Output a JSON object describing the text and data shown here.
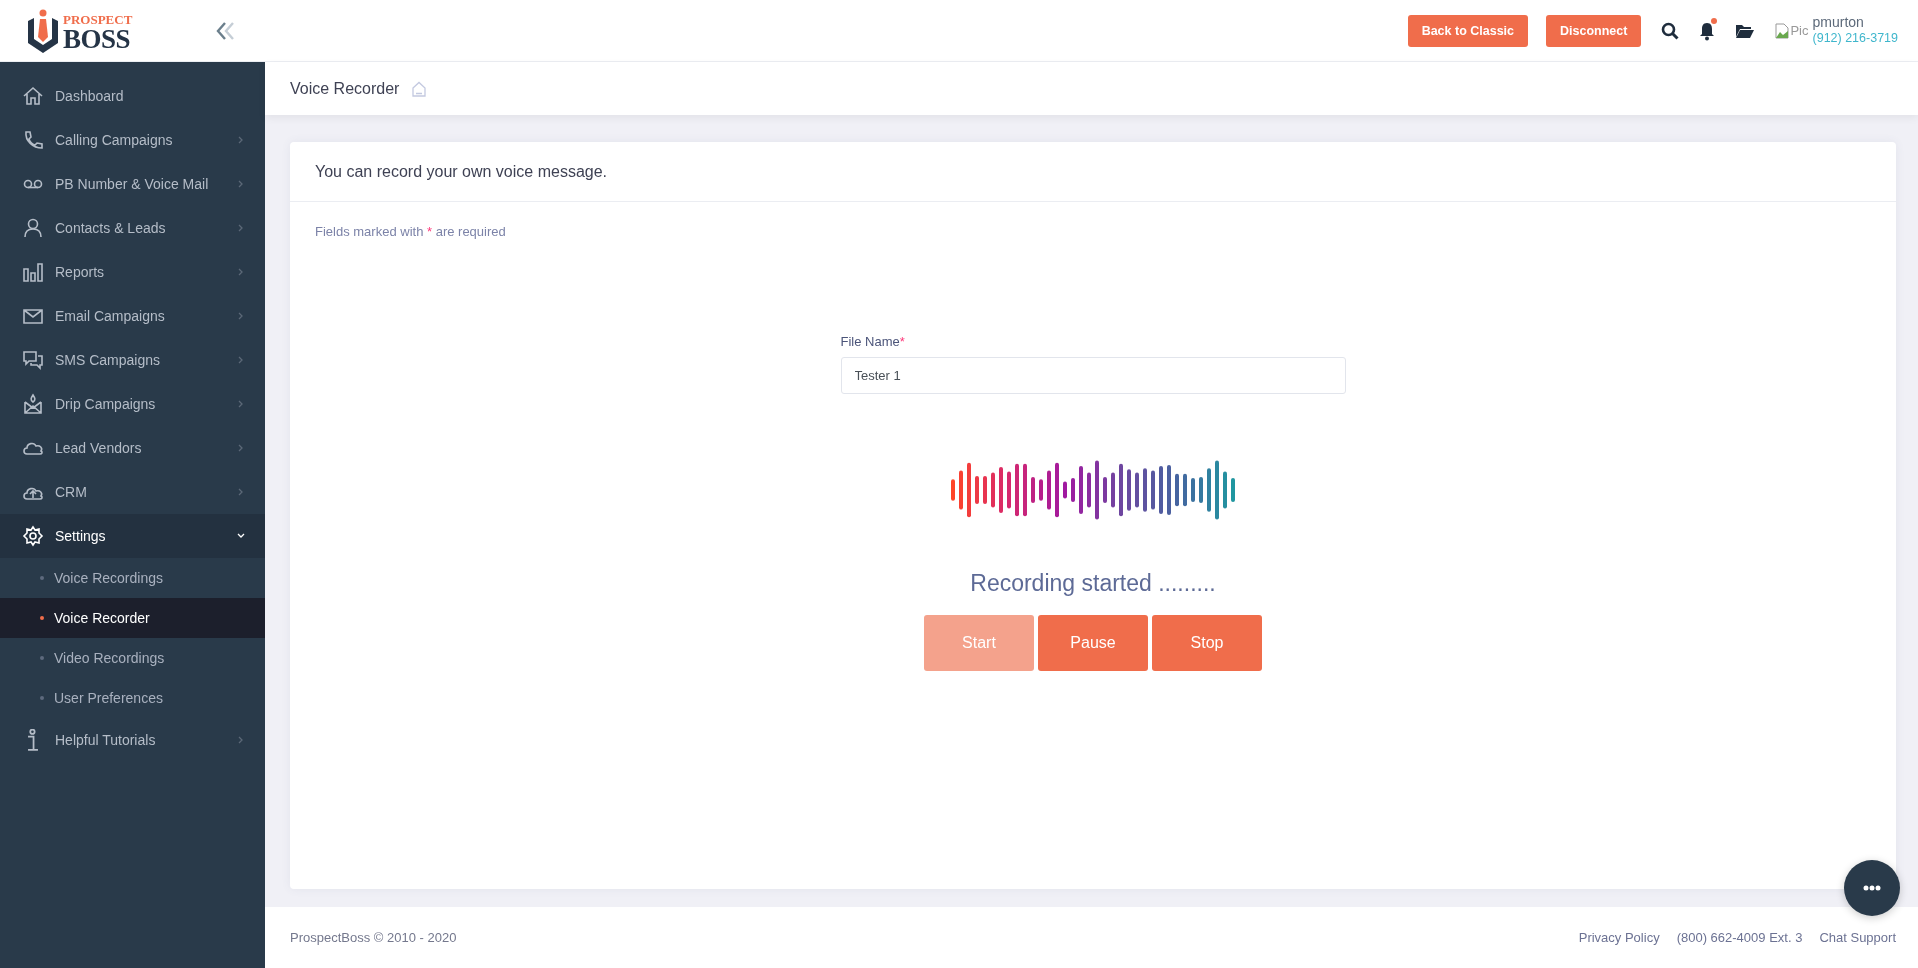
{
  "logo": {
    "top": "PROSPECT",
    "bottom": "BOSS"
  },
  "header": {
    "buttons": [
      "Back to Classic",
      "Disconnect"
    ],
    "notification_dot": true,
    "avatar_alt": "Pic",
    "user": {
      "name": "pmurton",
      "phone": "(912) 216-3719"
    }
  },
  "sidebar": {
    "items": [
      {
        "label": "Dashboard",
        "selected": false
      },
      {
        "label": "Calling Campaigns",
        "expanded": false,
        "selected": false
      },
      {
        "label": "PB Number & Voice Mail",
        "expanded": false,
        "selected": false
      },
      {
        "label": "Contacts & Leads",
        "expanded": false,
        "selected": false
      },
      {
        "label": "Reports",
        "expanded": false,
        "selected": false
      },
      {
        "label": "Email Campaigns",
        "expanded": false,
        "selected": false
      },
      {
        "label": "SMS Campaigns",
        "expanded": false,
        "selected": false
      },
      {
        "label": "Drip Campaigns",
        "expanded": false,
        "selected": false
      },
      {
        "label": "Lead Vendors",
        "expanded": false,
        "selected": false
      },
      {
        "label": "CRM",
        "expanded": false,
        "selected": false
      },
      {
        "label": "Settings",
        "expanded": true,
        "selected": true,
        "children": [
          {
            "label": "Voice Recordings",
            "selected": false
          },
          {
            "label": "Voice Recorder",
            "selected": true
          },
          {
            "label": "Video Recordings",
            "selected": false
          },
          {
            "label": "User Preferences",
            "selected": false
          }
        ]
      },
      {
        "label": "Helpful Tutorials",
        "expanded": false,
        "selected": false
      }
    ]
  },
  "page_title": "Voice Recorder",
  "card": {
    "title": "You can record your own voice message.",
    "required_note": {
      "before": "Fields marked with",
      "mark": "*",
      "after": "are required"
    },
    "field": {
      "label": "File Name",
      "required_mark": "*",
      "value": "Tester 1"
    },
    "status": "Recording started .........",
    "buttons": [
      {
        "label": "Start",
        "disabled": true
      },
      {
        "label": "Pause",
        "disabled": false
      },
      {
        "label": "Stop",
        "disabled": false
      }
    ]
  },
  "footer": {
    "copyright": "ProspectBoss © 2010 - 2020",
    "links": [
      "Privacy Policy",
      "(800) 662-4009 Ext. 3",
      "Chat Support"
    ]
  }
}
